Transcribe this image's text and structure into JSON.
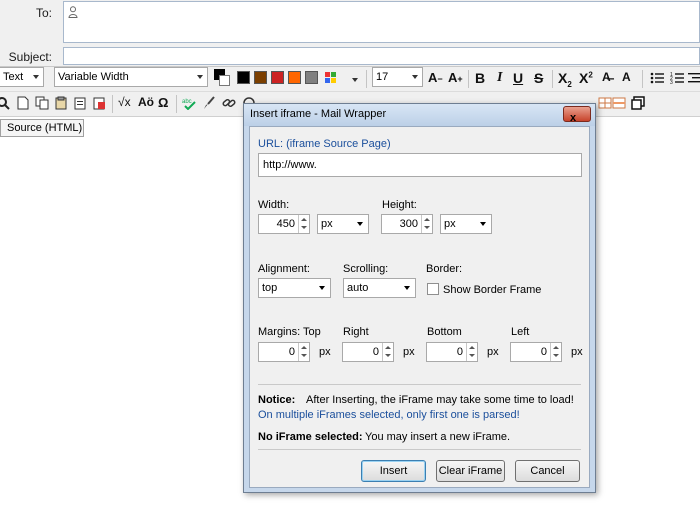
{
  "compose": {
    "to_label": "To:",
    "to_value": "",
    "subject_label": "Subject:",
    "subject_value": ""
  },
  "toolbar": {
    "format_select": "Text",
    "font_select": "Variable Width",
    "font_size": "17",
    "bold": "B",
    "italic": "I",
    "underline": "U",
    "strikethrough": "S",
    "subscript": "X",
    "subscript_mark": "2",
    "superscript": "X",
    "superscript_mark": "2",
    "special_char": "Ω",
    "accent_chars": "Aö",
    "text_color": "#000000",
    "palette": [
      "#000000",
      "#7b3f00",
      "#cc2222",
      "#ff6600",
      "#808080"
    ]
  },
  "source_tab": "Source (HTML)",
  "dialog": {
    "title": "Insert iframe - Mail Wrapper",
    "close": "x",
    "url_label": "URL: (iframe Source Page)",
    "url_value": "http://www.",
    "width_label": "Width:",
    "width_value": "450",
    "width_unit": "px",
    "height_label": "Height:",
    "height_value": "300",
    "height_unit": "px",
    "alignment_label": "Alignment:",
    "alignment_value": "top",
    "scrolling_label": "Scrolling:",
    "scrolling_value": "auto",
    "border_label": "Border:",
    "border_checkbox_label": "Show Border Frame",
    "margins": {
      "top_label": "Margins: Top",
      "right_label": "Right",
      "bottom_label": "Bottom",
      "left_label": "Left",
      "top_value": "0",
      "right_value": "0",
      "bottom_value": "0",
      "left_value": "0",
      "unit": "px"
    },
    "notice_label": "Notice:",
    "notice_text": "After Inserting, the iFrame may take some time to load!",
    "notice_text2": "On multiple iFrames selected, only first one is parsed!",
    "selection_label": "No iFrame selected:",
    "selection_text": "You may insert a new iFrame.",
    "buttons": {
      "insert": "Insert",
      "clear": "Clear iFrame",
      "cancel": "Cancel"
    }
  }
}
